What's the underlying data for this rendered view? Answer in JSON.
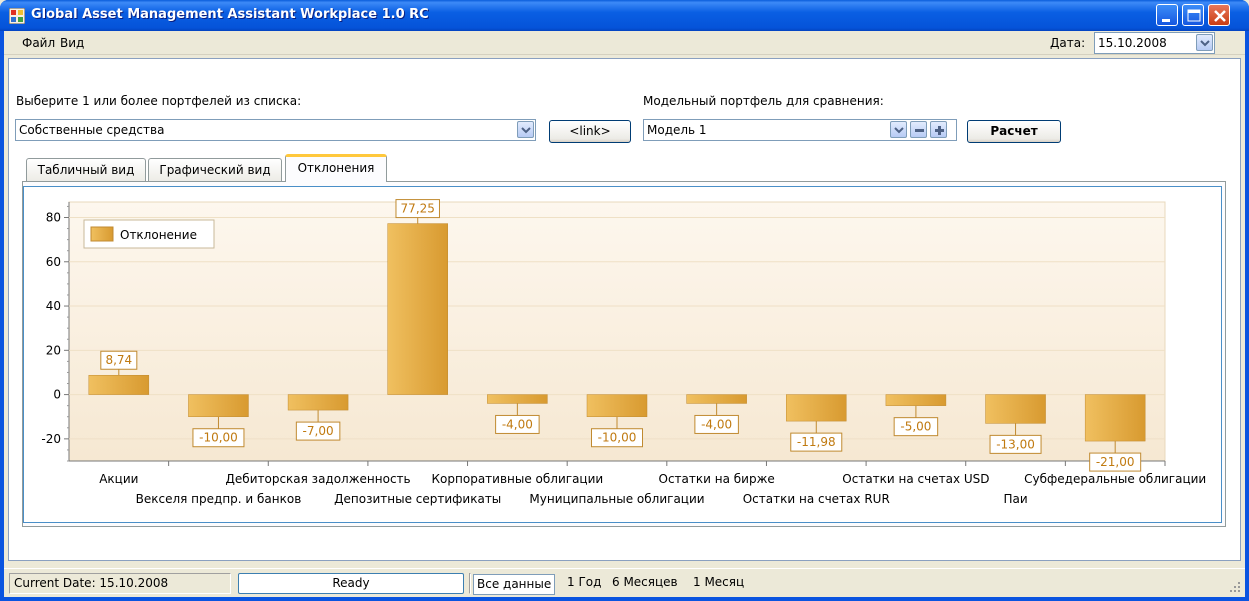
{
  "window": {
    "title": "Global Asset Management Assistant Workplace 1.0 RC"
  },
  "menu": {
    "file": "Файл",
    "view": "Вид",
    "date_label": "Дата:",
    "date_value": "15.10.2008"
  },
  "selection": {
    "portfolio_label": "Выберите 1 или более портфелей из списка:",
    "portfolio_value": "Собственные средства",
    "link_button": "<link>",
    "model_label": "Модельный портфель для сравнения:",
    "model_value": "Модель 1",
    "calc_button": "Расчет"
  },
  "tabs": [
    {
      "label": "Табличный вид"
    },
    {
      "label": "Графический вид"
    },
    {
      "label": "Отклонения"
    }
  ],
  "colors": {
    "bar_top": "#f0c060",
    "bar_bottom": "#d89a30",
    "label_text": "#c07a10",
    "plot_bg_top": "#fdf7ee",
    "plot_bg_bottom": "#f6e8d2"
  },
  "chart_data": {
    "type": "bar",
    "legend": [
      "Отклонение"
    ],
    "legend_position": "top-left",
    "ylim": [
      -30,
      87
    ],
    "yticks": [
      80,
      60,
      40,
      20,
      0,
      -20
    ],
    "grid": true,
    "categories": [
      "Акции",
      "Векселя предпр. и банков",
      "Дебиторская задолженность",
      "Депозитные сертификаты",
      "Корпоративные облигации",
      "Муниципальные облигации",
      "Остатки на бирже",
      "Остатки на счетах RUR",
      "Остатки на счетах USD",
      "Паи",
      "Субфедеральные облигации"
    ],
    "series": [
      {
        "name": "Отклонение",
        "values": [
          8.74,
          -10.0,
          -7.0,
          77.25,
          -4.0,
          -10.0,
          -4.0,
          -11.98,
          -5.0,
          -13.0,
          -21.0
        ],
        "labels": [
          "8,74",
          "-10,00",
          "-7,00",
          "77,25",
          "-4,00",
          "-10,00",
          "-4,00",
          "-11,98",
          "-5,00",
          "-13,00",
          "-21,00"
        ]
      }
    ]
  },
  "status": {
    "current_date": "Current Date: 15.10.2008",
    "state": "Ready",
    "all_data": "Все данные",
    "period_1y": "1 Год",
    "period_6m": "6 Месяцев",
    "period_1m": "1 Месяц"
  }
}
